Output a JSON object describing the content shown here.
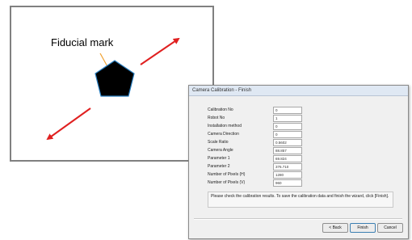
{
  "illustration": {
    "label": "Fiducial mark",
    "colors": {
      "panel_border": "#808080",
      "arrow": "#e02020",
      "pentagon_fill": "#000000",
      "pentagon_outline": "#2a7fc0",
      "leader_line": "#f0a030"
    },
    "icons": [
      "pentagon-fiducial-icon",
      "arrow-icon"
    ]
  },
  "dialog": {
    "title": "Camera Calibration - Finish",
    "fields": [
      {
        "label": "Calibration No",
        "value": "0"
      },
      {
        "label": "Robot No",
        "value": "1"
      },
      {
        "label": "Installation method",
        "value": "0"
      },
      {
        "label": "Camera Direction",
        "value": "0"
      },
      {
        "label": "Scale Ratio",
        "value": "0.5602"
      },
      {
        "label": "Camera Angle",
        "value": "88.857"
      },
      {
        "label": "Parameter 1",
        "value": "69.824"
      },
      {
        "label": "Parameter 2",
        "value": "376.710"
      },
      {
        "label": "Number of Pixels (H)",
        "value": "1280"
      },
      {
        "label": "Number of Pixels (V)",
        "value": "960"
      }
    ],
    "message": "Please check the calibration results. To save the calibration data and finish the wizard, click [Finish].",
    "buttons": {
      "back": "< Back",
      "finish": "Finish",
      "cancel": "Cancel"
    }
  }
}
